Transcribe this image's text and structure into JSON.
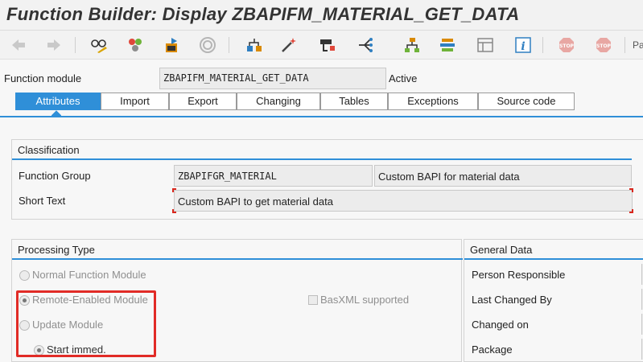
{
  "window": {
    "title": "Function Builder: Display ZBAPIFM_MATERIAL_GET_DATA"
  },
  "toolbar": {
    "icons": [
      "back-arrow-icon",
      "forward-arrow-icon",
      "glasses-pencil-icon",
      "other-object-icon",
      "activate-icon",
      "where-used-icon",
      "object-hierarchy-icon",
      "magic-wand-icon",
      "display-object-list-icon",
      "navigation-icon",
      "hierarchy-tree-icon",
      "stack-icon",
      "info-icon",
      "stop-icon",
      "stop-icon",
      "screen-layout-icon"
    ],
    "trailing_text": "Pa"
  },
  "header": {
    "function_module_label": "Function module",
    "function_module_value": "ZBAPIFM_MATERIAL_GET_DATA",
    "status": "Active"
  },
  "tabs": [
    {
      "label": "Attributes",
      "active": true
    },
    {
      "label": "Import",
      "active": false
    },
    {
      "label": "Export",
      "active": false
    },
    {
      "label": "Changing",
      "active": false
    },
    {
      "label": "Tables",
      "active": false
    },
    {
      "label": "Exceptions",
      "active": false
    },
    {
      "label": "Source code",
      "active": false
    }
  ],
  "classification": {
    "title": "Classification",
    "function_group_label": "Function Group",
    "function_group_value": "ZBAPIFGR_MATERIAL",
    "function_group_desc": "Custom BAPI for material data",
    "short_text_label": "Short Text",
    "short_text_value": "Custom BAPI to get material data"
  },
  "processing": {
    "title": "Processing Type",
    "options": {
      "normal": {
        "label": "Normal Function Module",
        "selected": false
      },
      "remote": {
        "label": "Remote-Enabled Module",
        "selected": true
      },
      "update": {
        "label": "Update Module",
        "selected": false
      },
      "start_immed": {
        "label": "Start immed.",
        "selected": true
      }
    },
    "basxml_label": "BasXML supported",
    "basxml_checked": false
  },
  "general": {
    "title": "General Data",
    "person_responsible": "Person Responsible",
    "last_changed_by": "Last Changed By",
    "changed_on": "Changed on",
    "package": "Package"
  },
  "colors": {
    "accent": "#2f8fd8",
    "highlight": "#e12b26"
  }
}
